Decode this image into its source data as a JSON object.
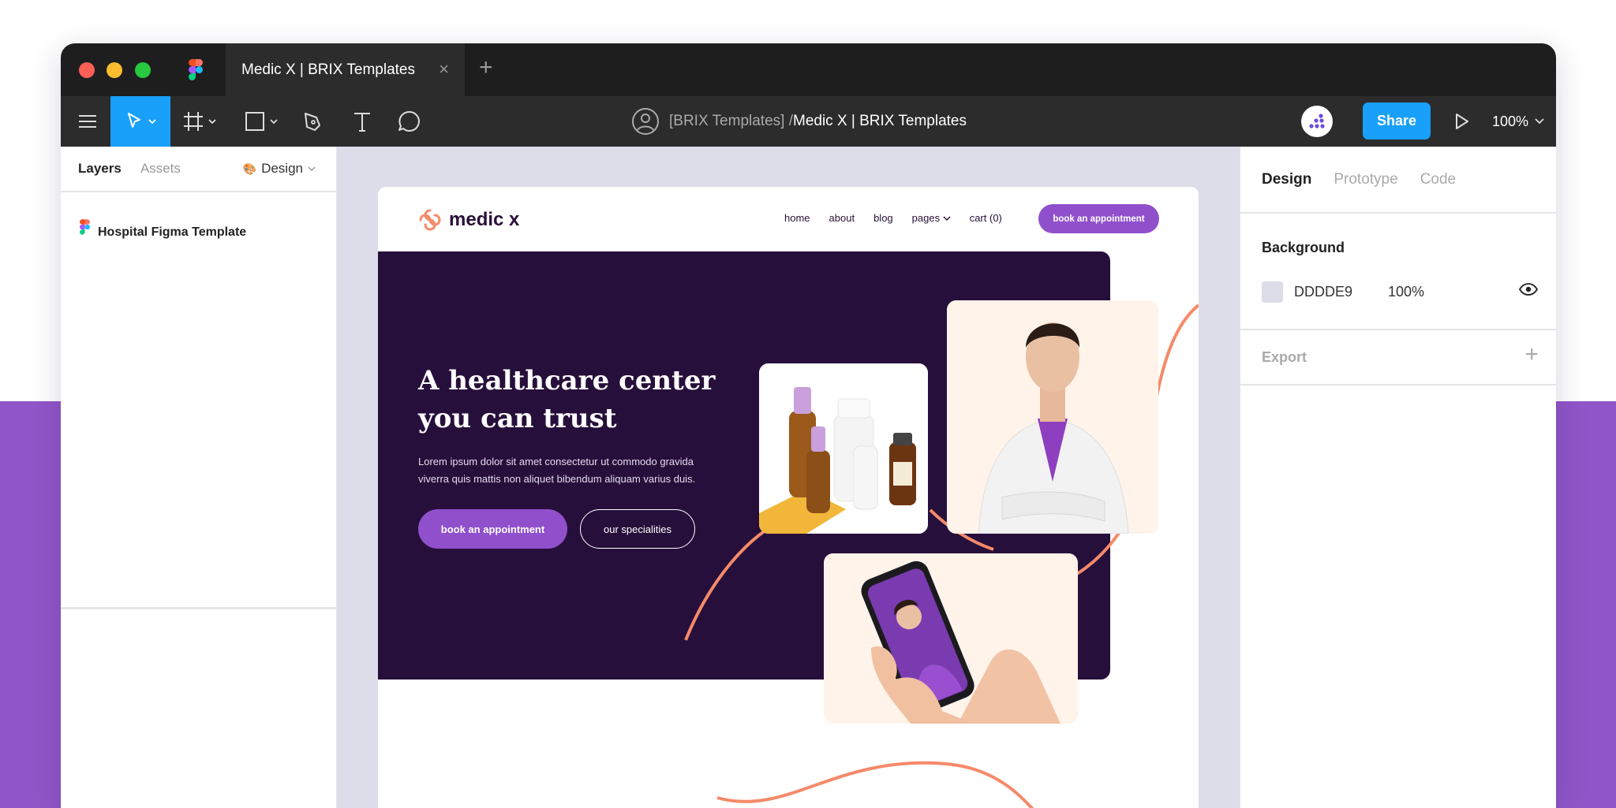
{
  "window": {
    "tab_title": "Medic X | BRIX Templates",
    "tab_close": "×",
    "tab_add": "+"
  },
  "toolbar": {
    "breadcrumb_team": "[BRIX Templates] /",
    "breadcrumb_file": "Medic X | BRIX Templates",
    "share_label": "Share",
    "zoom_label": "100%",
    "tools": [
      "main-menu-icon",
      "move-tool-icon",
      "frame-tool-icon",
      "shape-tool-icon",
      "pen-tool-icon",
      "text-tool-icon",
      "comment-tool-icon"
    ],
    "accent_color": "#18a0fb"
  },
  "left_panel": {
    "tabs": [
      "Layers",
      "Assets"
    ],
    "design_label": "Design",
    "layer_name": "Hospital Figma Template"
  },
  "artboard": {
    "logo_text": "medic x",
    "nav": [
      "home",
      "about",
      "blog",
      "pages",
      "cart (0)"
    ],
    "nav_cta": "book an appointment",
    "hero_title_line1": "A healthcare center",
    "hero_title_line2": "you can trust",
    "hero_text_line1": "Lorem ipsum dolor sit amet consectetur ut commodo gravida",
    "hero_text_line2": "viverra quis mattis non aliquet bibendum aliquam varius duis.",
    "hero_btn_primary": "book an appointment",
    "hero_btn_secondary": "our specialities",
    "brand_color": "#9050cc",
    "hero_bg": "#270f3b",
    "accent_curve": "#f58a6a"
  },
  "right_panel": {
    "tabs": [
      "Design",
      "Prototype",
      "Code"
    ],
    "background_heading": "Background",
    "background_hex": "DDDDE9",
    "background_opacity": "100%",
    "background_color": "#dddde9",
    "export_heading": "Export",
    "export_add": "+"
  }
}
